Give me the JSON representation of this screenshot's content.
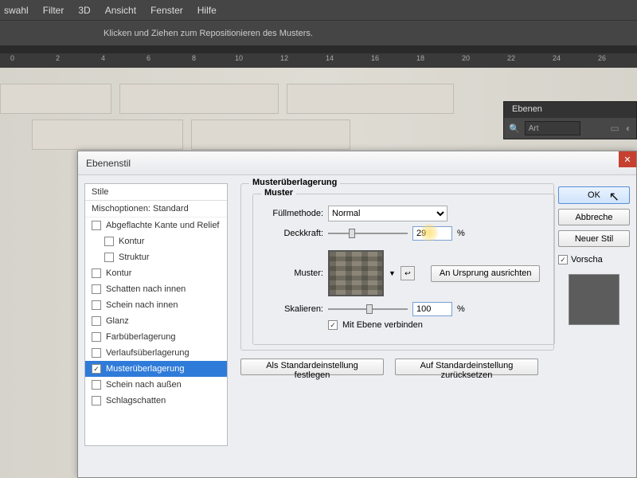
{
  "menu": [
    "swahl",
    "Filter",
    "3D",
    "Ansicht",
    "Fenster",
    "Hilfe"
  ],
  "hint": "Klicken und Ziehen zum Repositionieren des Musters.",
  "ruler_ticks": [
    0,
    2,
    4,
    6,
    8,
    10,
    12,
    14,
    16,
    18,
    20,
    22,
    24,
    26
  ],
  "layers_panel": {
    "tab": "Ebenen",
    "kind": "Art"
  },
  "dialog": {
    "title": "Ebenenstil",
    "styles_header": "Stile",
    "mixing": "Mischoptionen: Standard",
    "items": [
      {
        "label": "Abgeflachte Kante und Relief",
        "checked": false,
        "sub": false
      },
      {
        "label": "Kontur",
        "checked": false,
        "sub": true
      },
      {
        "label": "Struktur",
        "checked": false,
        "sub": true
      },
      {
        "label": "Kontur",
        "checked": false,
        "sub": false
      },
      {
        "label": "Schatten nach innen",
        "checked": false,
        "sub": false
      },
      {
        "label": "Schein nach innen",
        "checked": false,
        "sub": false
      },
      {
        "label": "Glanz",
        "checked": false,
        "sub": false
      },
      {
        "label": "Farbüberlagerung",
        "checked": false,
        "sub": false
      },
      {
        "label": "Verlaufsüberlagerung",
        "checked": false,
        "sub": false
      },
      {
        "label": "Musterüberlagerung",
        "checked": true,
        "sub": false,
        "selected": true
      },
      {
        "label": "Schein nach außen",
        "checked": false,
        "sub": false
      },
      {
        "label": "Schlagschatten",
        "checked": false,
        "sub": false
      }
    ],
    "section_title": "Musterüberlagerung",
    "group_title": "Muster",
    "blend_label": "Füllmethode:",
    "blend_value": "Normal",
    "opacity_label": "Deckkraft:",
    "opacity_value": "29",
    "pct": "%",
    "pattern_label": "Muster:",
    "snap_btn": "An Ursprung ausrichten",
    "scale_label": "Skalieren:",
    "scale_value": "100",
    "link_label": "Mit Ebene verbinden",
    "link_checked": true,
    "default_set": "Als Standardeinstellung festlegen",
    "default_reset": "Auf Standardeinstellung zurücksetzen",
    "ok": "OK",
    "cancel": "Abbreche",
    "newstyle": "Neuer Stil",
    "preview": "Vorscha"
  }
}
